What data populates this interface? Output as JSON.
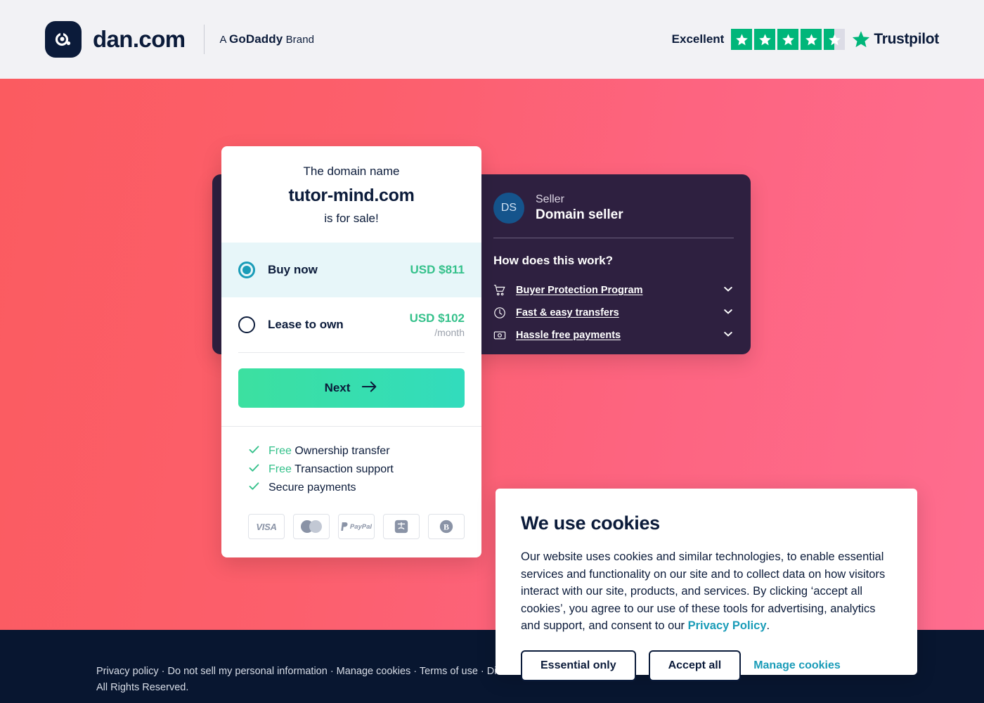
{
  "header": {
    "brand_name": "dan.com",
    "brand_sub_prefix": "A ",
    "brand_sub_go": "GoDaddy",
    "brand_sub_suffix": " Brand",
    "logo_icon": "dan-logo-icon",
    "trustpilot": {
      "rating_word": "Excellent",
      "stars_filled": 4,
      "stars_total": 5,
      "half_star": true,
      "logo_text": "Trustpilot",
      "star_color": "#00b67a",
      "empty_star_color": "#dcdce6"
    }
  },
  "domain_card": {
    "pre_text": "The domain name",
    "domain": "tutor-mind.com",
    "post_text": "is for sale!",
    "options": [
      {
        "id": "buy-now",
        "label": "Buy now",
        "price": "USD $811",
        "price_sub": "",
        "selected": true
      },
      {
        "id": "lease-to-own",
        "label": "Lease to own",
        "price": "USD $102",
        "price_sub": "/month",
        "selected": false
      }
    ],
    "next_label": "Next",
    "next_icon": "arrow-right-icon",
    "features": [
      {
        "free": "Free",
        "text": " Ownership transfer"
      },
      {
        "free": "Free",
        "text": " Transaction support"
      },
      {
        "free": "",
        "text": "Secure payments"
      }
    ],
    "payment_methods": [
      {
        "name": "visa-icon",
        "label": "VISA"
      },
      {
        "name": "mastercard-icon",
        "label": ""
      },
      {
        "name": "paypal-icon",
        "label": "PayPal"
      },
      {
        "name": "alipay-icon",
        "label": ""
      },
      {
        "name": "bitcoin-icon",
        "label": ""
      }
    ]
  },
  "seller_panel": {
    "avatar_initials": "DS",
    "role_label": "Seller",
    "seller_name": "Domain seller",
    "work_title": "How does this work?",
    "accordion": [
      {
        "icon": "shopping-cart-icon",
        "label": "Buyer Protection Program",
        "chevron": "chevron-down-icon"
      },
      {
        "icon": "clock-icon",
        "label": "Fast & easy transfers",
        "chevron": "chevron-down-icon"
      },
      {
        "icon": "banknote-icon",
        "label": "Hassle free payments",
        "chevron": "chevron-down-icon"
      }
    ]
  },
  "cookie_banner": {
    "title": "We use cookies",
    "body_part1": "Our website uses cookies and similar technologies, to enable essential services and functionality on our site and to collect data on how visitors interact with our site, products, and services. By clicking ‘accept all cookies’, you agree to our use of these tools for advertising, analytics and support, and consent to our ",
    "privacy_link": "Privacy Policy",
    "body_part2": ".",
    "essential_only_label": "Essential only",
    "accept_all_label": "Accept all",
    "manage_cookies_label": "Manage cookies"
  },
  "footer": {
    "text": "Privacy policy · Do not sell my personal information · Manage cookies · Terms of use · Disclaimer subsidiary. All Rights Reserved."
  },
  "colors": {
    "accent_green": "#35c18b",
    "accent_teal": "#1a9cb8",
    "navy": "#0b1b3a",
    "panel_purple": "#2e2040",
    "bg_left": "#fb5b60",
    "bg_right": "#fe6d8f",
    "footer_navy": "#081630"
  }
}
